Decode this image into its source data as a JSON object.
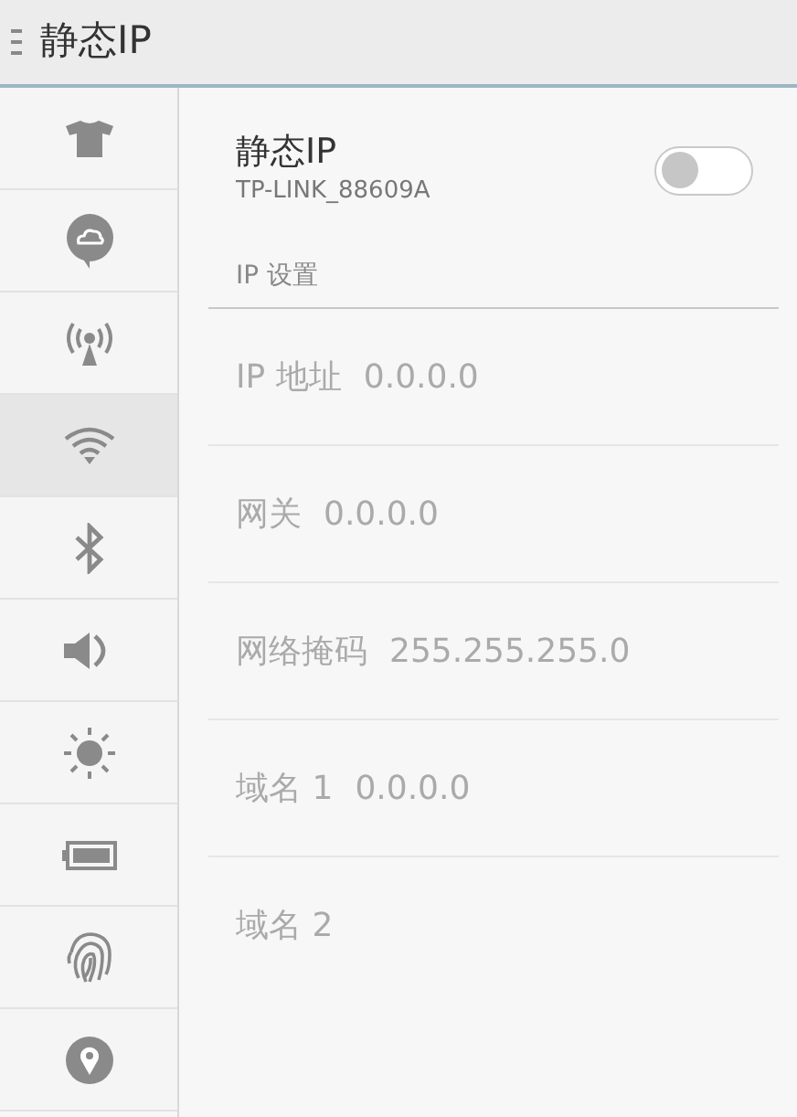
{
  "header": {
    "title": "静态IP"
  },
  "sidebar": {
    "items": [
      {
        "selected": false
      },
      {
        "selected": false
      },
      {
        "selected": false
      },
      {
        "selected": true
      },
      {
        "selected": false
      },
      {
        "selected": false
      },
      {
        "selected": false
      },
      {
        "selected": false
      },
      {
        "selected": false
      },
      {
        "selected": false
      }
    ]
  },
  "static_ip": {
    "title": "静态IP",
    "subtitle": "TP-LINK_88609A",
    "on": false
  },
  "section": {
    "title": "IP 设置"
  },
  "fields": [
    {
      "label": "IP 地址",
      "value": "0.0.0.0",
      "disabled": true
    },
    {
      "label": "网关",
      "value": "0.0.0.0",
      "disabled": true
    },
    {
      "label": "网络掩码",
      "value": "255.255.255.0",
      "disabled": true
    },
    {
      "label": "域名 1",
      "value": "0.0.0.0",
      "disabled": true
    },
    {
      "label": "域名 2",
      "disabled": true
    }
  ]
}
